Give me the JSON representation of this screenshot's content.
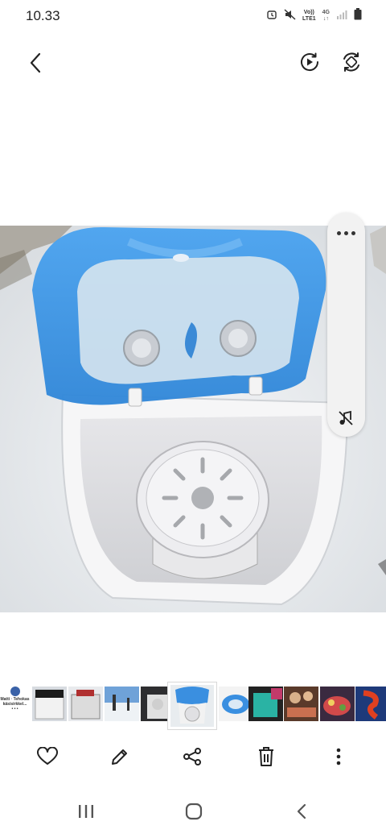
{
  "status_bar": {
    "time": "10.33",
    "lte_top": "Vo))",
    "lte_bottom": "LTE1",
    "network": "4G",
    "network_arrows": "↓↑"
  },
  "top_bar": {
    "back_icon": "chevron-left-icon",
    "play_icon": "motion-play-icon",
    "remaster_icon": "auto-rotate-icon"
  },
  "side_panel": {
    "more_icon": "more-horizontal-icon",
    "mute_icon": "mute-icon"
  },
  "thumbnail_strip": {
    "caption": "Matti · Tehokas käsisirkkel...",
    "caption_dots": "• • •",
    "thumbnails": [
      "washer-open",
      "washer-closed",
      "snow-field",
      "washer-boxed",
      "washer-top-active",
      "washer-blue",
      "teal-bag",
      "people-table",
      "food-plate",
      "red-figure"
    ]
  },
  "actions": {
    "favorite_icon": "heart-icon",
    "edit_icon": "pencil-icon",
    "share_icon": "share-icon",
    "delete_icon": "trash-icon",
    "more_icon": "more-vertical-icon"
  },
  "nav_bar": {
    "recents_icon": "recents-icon",
    "home_icon": "home-icon",
    "back_icon": "back-icon"
  },
  "colors": {
    "lid_blue": "#3a8fe0",
    "snow": "#e9ecef",
    "panel": "#f2f2f2"
  }
}
